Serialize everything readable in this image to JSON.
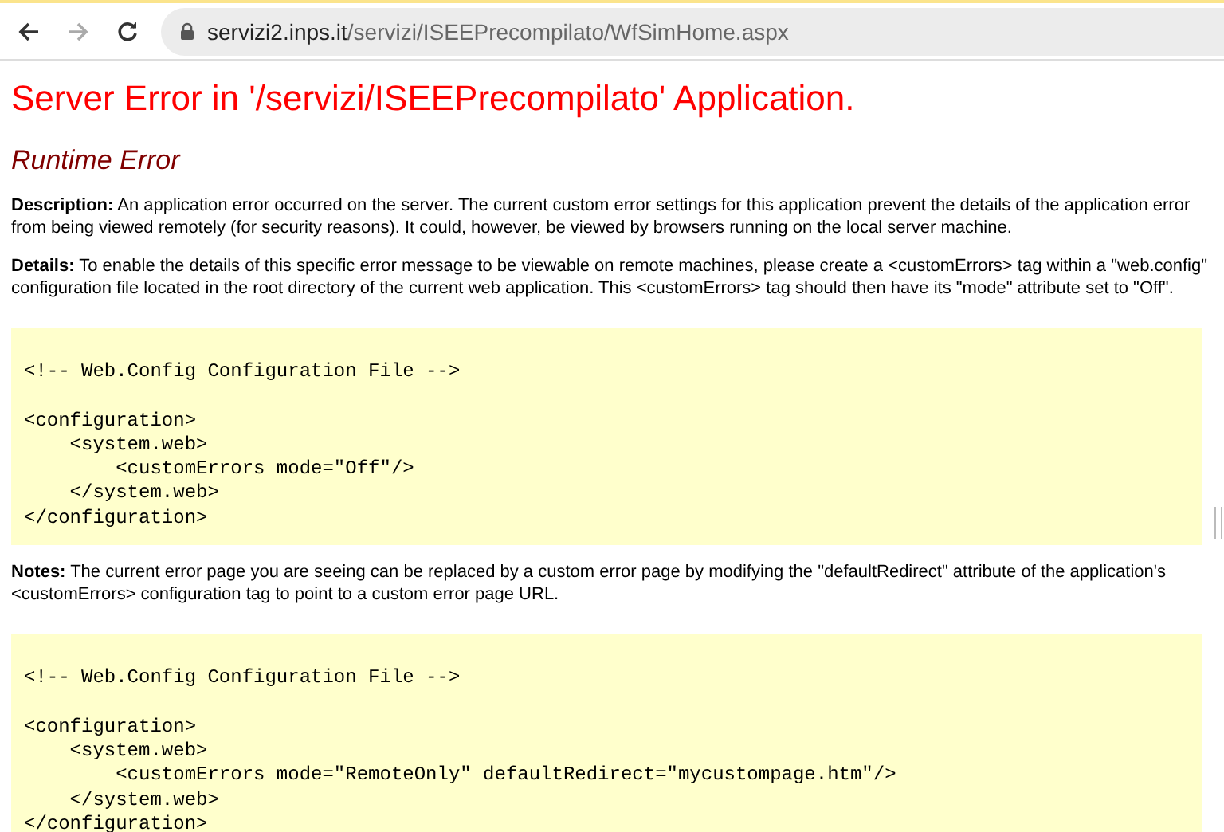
{
  "browser": {
    "url_host": "servizi2.inps.it",
    "url_path": "/servizi/ISEEPrecompilato/WfSimHome.aspx"
  },
  "page": {
    "title": "Server Error in '/servizi/ISEEPrecompilato' Application.",
    "subtitle": "Runtime Error",
    "sections": [
      {
        "kind": "text",
        "text": "**Description:** An application error occurred on the server. The current custom error settings for this application prevent the details of the application error from being viewed remotely (for security reasons). It could, however, be viewed by browsers running on the local server machine."
      },
      {
        "kind": "text",
        "text": "**Details:** To enable the details of this specific error message to be viewable on remote machines, please create a <customErrors> tag within a \"web.config\" configuration file located in the root directory of the current web application. This <customErrors> tag should then have its \"mode\" attribute set to \"Off\"."
      },
      {
        "kind": "code",
        "comment": "<!-- Web.Config Configuration File -->",
        "lines": [
          "<configuration>",
          "    <system.web>",
          "        <customErrors mode=\"Off\"/>",
          "    </system.web>",
          "</configuration>"
        ]
      },
      {
        "kind": "text",
        "text": "**Notes:** The current error page you are seeing can be replaced by a custom error page by modifying the \"defaultRedirect\" attribute of the application's <customErrors> configuration tag to point to a custom error page URL."
      },
      {
        "kind": "code",
        "comment": "<!-- Web.Config Configuration File -->",
        "lines": [
          "<configuration>",
          "    <system.web>",
          "        <customErrors mode=\"RemoteOnly\" defaultRedirect=\"mycustompage.htm\"/>",
          "    </system.web>",
          "</configuration>"
        ]
      }
    ]
  }
}
